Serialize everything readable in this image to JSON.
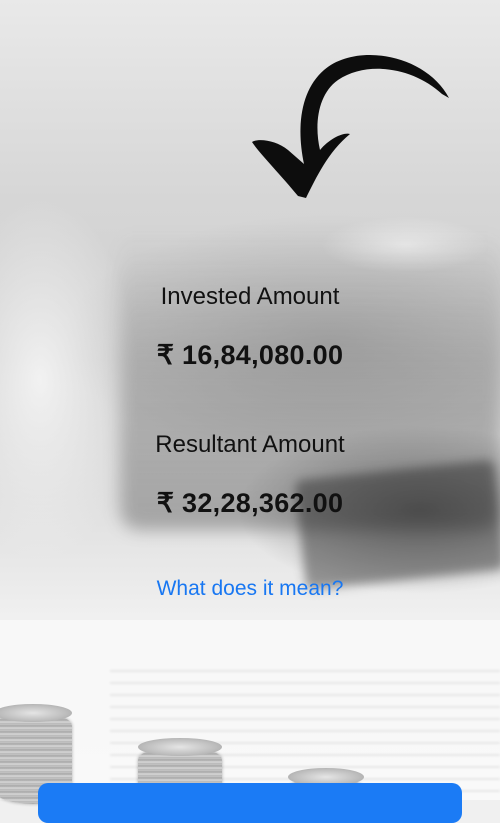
{
  "summary": {
    "invested_label": "Invested Amount",
    "invested_value": "₹ 16,84,080.00",
    "resultant_label": "Resultant Amount",
    "resultant_value": "₹ 32,28,362.00",
    "explain_link": "What does it mean?"
  },
  "icons": {
    "arrow": "curved-arrow-icon"
  },
  "colors": {
    "link": "#1877f2",
    "button": "#1b7bf5",
    "text": "#111111"
  }
}
